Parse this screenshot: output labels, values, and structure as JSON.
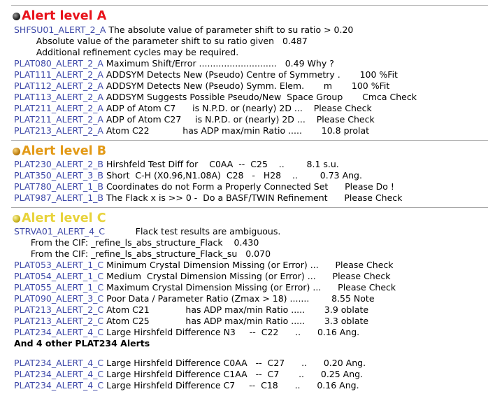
{
  "sections": {
    "a": {
      "title": "Alert level A",
      "color": "#e8121a",
      "rows": [
        {
          "code": "SHFSU01_ALERT_2_A",
          "text": " The absolute value of parameter shift to su ratio > 0.20"
        },
        {
          "code": "",
          "text": "        Absolute value of the parameter shift to su ratio given   0.487"
        },
        {
          "code": "",
          "text": "        Additional refinement cycles may be required."
        },
        {
          "code": "PLAT080_ALERT_2_A",
          "text": " Maximum Shift/Error ............................   0.49 Why ?"
        },
        {
          "code": "PLAT111_ALERT_2_A",
          "text": " ADDSYM Detects New (Pseudo) Centre of Symmetry .       100 %Fit"
        },
        {
          "code": "PLAT112_ALERT_2_A",
          "text": " ADDSYM Detects New (Pseudo) Symm. Elem.       m       100 %Fit"
        },
        {
          "code": "PLAT113_ALERT_2_A",
          "text": " ADDSYM Suggests Possible Pseudo/New  Space Group       Cmca Check"
        },
        {
          "code": "PLAT211_ALERT_2_A",
          "text": " ADP of Atom C7      is N.P.D. or (nearly) 2D ...    Please Check"
        },
        {
          "code": "PLAT211_ALERT_2_A",
          "text": " ADP of Atom C27     is N.P.D. or (nearly) 2D ...    Please Check"
        },
        {
          "code": "PLAT213_ALERT_2_A",
          "text": " Atom C22            has ADP max/min Ratio .....       10.8 prolat"
        }
      ]
    },
    "b": {
      "title": "Alert level B",
      "color": "#e39a17",
      "rows": [
        {
          "code": "PLAT230_ALERT_2_B",
          "text": " Hirshfeld Test Diff for    C0AA  --  C25    ..        8.1 s.u."
        },
        {
          "code": "PLAT350_ALERT_3_B",
          "text": " Short  C-H (X0.96,N1.08A)  C28   -   H28    ..        0.73 Ang."
        },
        {
          "code": "PLAT780_ALERT_1_B",
          "text": " Coordinates do not Form a Properly Connected Set      Please Do !"
        },
        {
          "code": "PLAT987_ALERT_1_B",
          "text": " The Flack x is >> 0 -  Do a BASF/TWIN Refinement      Please Check"
        }
      ]
    },
    "c": {
      "title": "Alert level C",
      "color": "#e8d33b",
      "rows": [
        {
          "code": "STRVA01_ALERT_4_C",
          "text": "           Flack test results are ambiguous."
        },
        {
          "code": "",
          "text": "      From the CIF: _refine_ls_abs_structure_Flack    0.430"
        },
        {
          "code": "",
          "text": "      From the CIF: _refine_ls_abs_structure_Flack_su   0.070"
        },
        {
          "code": "PLAT053_ALERT_1_C",
          "text": " Minimum Crystal Dimension Missing (or Error) ...      Please Check"
        },
        {
          "code": "PLAT054_ALERT_1_C",
          "text": " Medium  Crystal Dimension Missing (or Error) ...      Please Check"
        },
        {
          "code": "PLAT055_ALERT_1_C",
          "text": " Maximum Crystal Dimension Missing (or Error) ...      Please Check"
        },
        {
          "code": "PLAT090_ALERT_3_C",
          "text": " Poor Data / Parameter Ratio (Zmax > 18) .......        8.55 Note"
        },
        {
          "code": "PLAT213_ALERT_2_C",
          "text": " Atom C21             has ADP max/min Ratio .....       3.9 oblate"
        },
        {
          "code": "PLAT213_ALERT_2_C",
          "text": " Atom C25             has ADP max/min Ratio .....       3.3 oblate"
        },
        {
          "code": "PLAT234_ALERT_4_C",
          "text": " Large Hirshfeld Difference N3     --  C22      ..      0.16 Ang."
        }
      ],
      "other_note": "And 4 other PLAT234 Alerts",
      "extra_rows": [
        {
          "code": "PLAT234_ALERT_4_C",
          "text": " Large Hirshfeld Difference C0AA   --  C27      ..      0.20 Ang."
        },
        {
          "code": "PLAT234_ALERT_4_C",
          "text": " Large Hirshfeld Difference C1AA   --  C7       ..      0.25 Ang."
        },
        {
          "code": "PLAT234_ALERT_4_C",
          "text": " Large Hirshfeld Difference C7     --  C18      ..      0.16 Ang."
        }
      ]
    }
  }
}
